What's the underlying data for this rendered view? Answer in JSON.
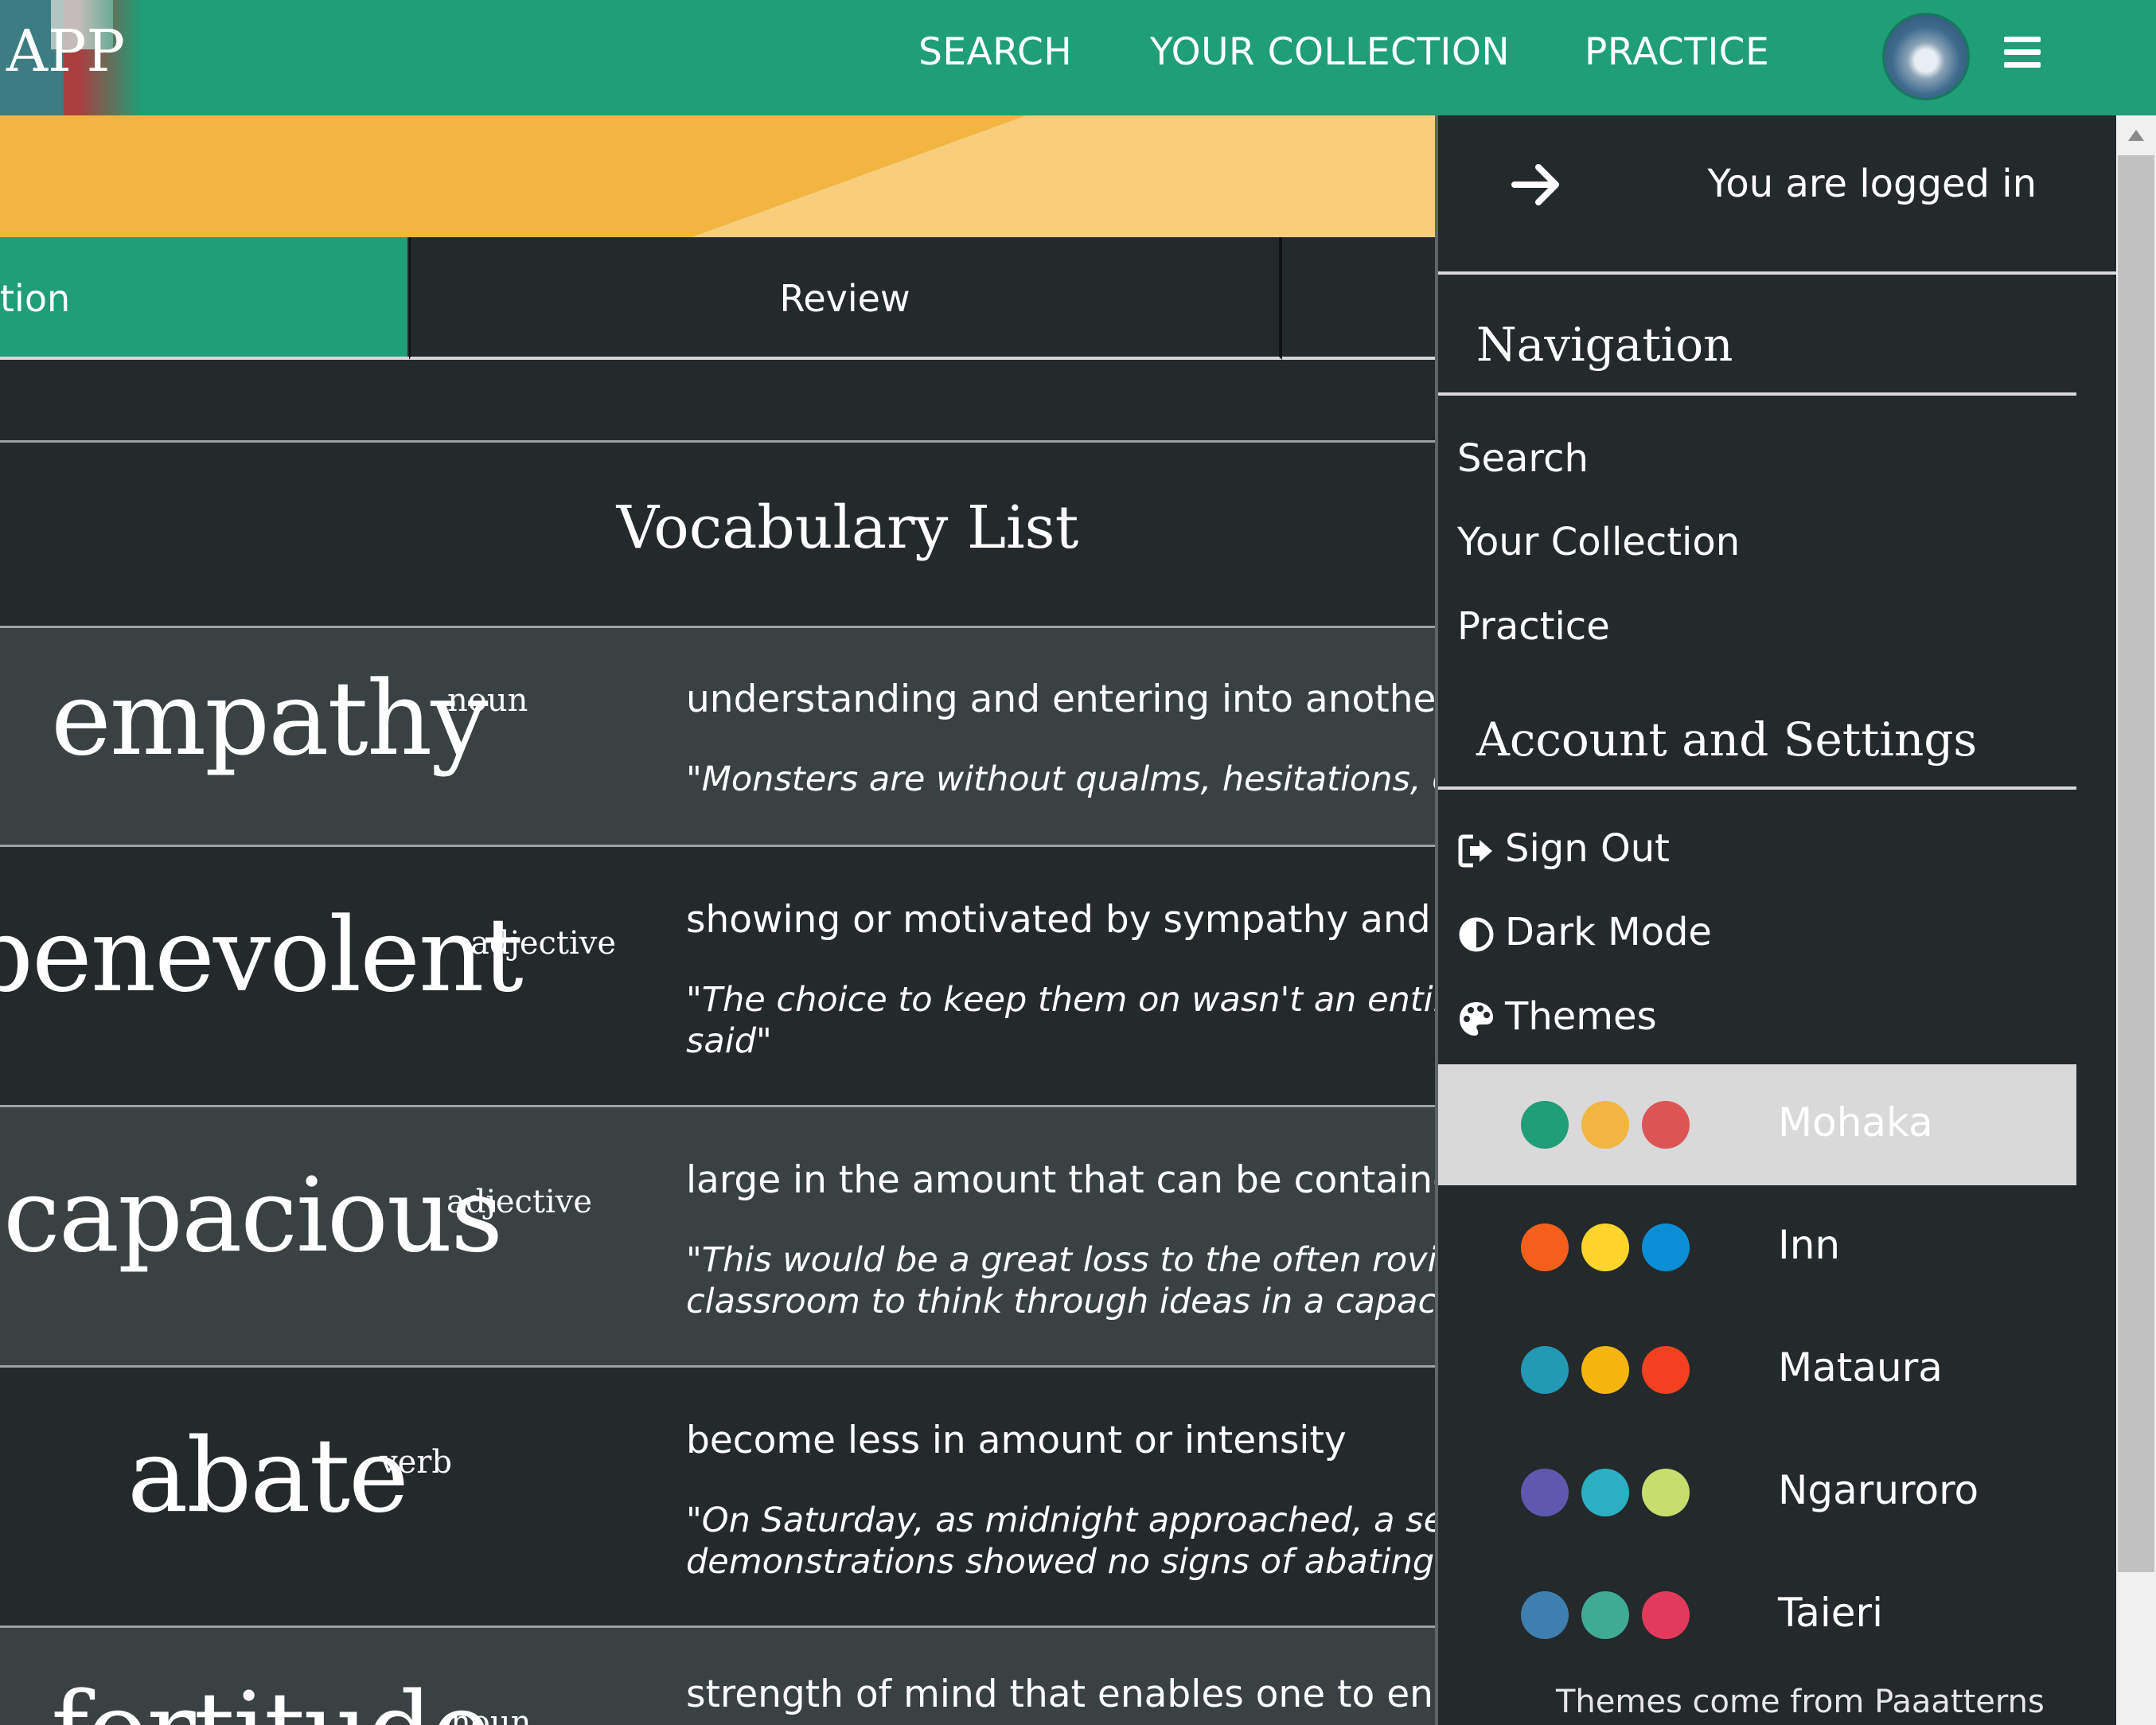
{
  "header": {
    "logo_text": "APP",
    "nav": [
      "SEARCH",
      "YOUR COLLECTION",
      "PRACTICE"
    ]
  },
  "tabs": {
    "active_partial": "tion",
    "review": "Review"
  },
  "main": {
    "title": "Vocabulary List",
    "words": [
      {
        "word": "empathy",
        "pos": "noun",
        "definition": "understanding and entering into another's",
        "example": "\"Monsters are without qualms, hesitations, emp"
      },
      {
        "word": "benevolent",
        "pos": "adjective",
        "definition": "showing or motivated by sympathy and ur",
        "example": "\"The choice to keep them on wasn't an entirely\nsaid\""
      },
      {
        "word": "capacious",
        "pos": "adjective",
        "definition": "large in the amount that can be contained",
        "example": "\"This would be a great loss to the often roving s\nclassroom to think through ideas in a capaciou"
      },
      {
        "word": "abate",
        "pos": "verb",
        "definition": "become less in amount or intensity",
        "example": "\"On Saturday, as midnight approached, a secor\ndemonstrations showed no signs of abating\""
      },
      {
        "word": "fortitude",
        "pos": "noun",
        "definition": "strength of mind that enables one to endu",
        "example": ""
      }
    ]
  },
  "panel": {
    "status": "You are logged in",
    "navigation_heading": "Navigation",
    "nav_items": [
      "Search",
      "Your Collection",
      "Practice"
    ],
    "account_heading": "Account and Settings",
    "sign_out": "Sign Out",
    "dark_mode": "Dark Mode",
    "themes": "Themes",
    "theme_list": [
      {
        "name": "Mohaka",
        "selected": true,
        "colors": [
          "#1f9e78",
          "#f2b541",
          "#dc5454"
        ]
      },
      {
        "name": "Inn",
        "selected": false,
        "colors": [
          "#f65f1b",
          "#fdd42a",
          "#0a8fd6"
        ]
      },
      {
        "name": "Mataura",
        "selected": false,
        "colors": [
          "#2399b4",
          "#f5b50f",
          "#f4401f"
        ]
      },
      {
        "name": "Ngaruroro",
        "selected": false,
        "colors": [
          "#5d59ae",
          "#2ab0c1",
          "#c7dd6e"
        ]
      },
      {
        "name": "Taieri",
        "selected": false,
        "colors": [
          "#3f7fb0",
          "#3fab92",
          "#e23a5c"
        ]
      }
    ],
    "themes_note": "Themes come from Paaatterns"
  }
}
